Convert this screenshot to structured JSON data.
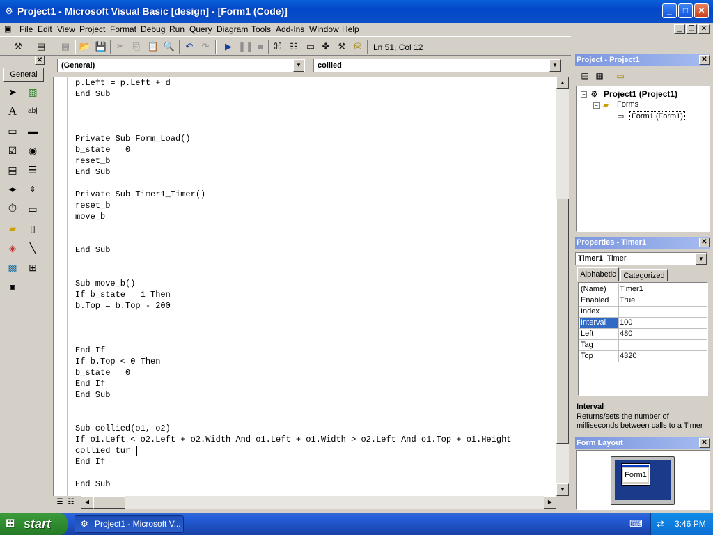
{
  "window": {
    "title": "Project1 - Microsoft Visual Basic [design] - [Form1 (Code)]",
    "minimize_glyph": "_",
    "maximize_glyph": "□",
    "close_glyph": "✕"
  },
  "menu": {
    "items": [
      "File",
      "Edit",
      "View",
      "Project",
      "Format",
      "Debug",
      "Run",
      "Query",
      "Diagram",
      "Tools",
      "Add-Ins",
      "Window",
      "Help"
    ]
  },
  "toolbar": {
    "status": "Ln 51, Col 12",
    "icons": [
      "add-project-icon",
      "add-form-icon",
      "menu-editor-icon",
      "open-icon",
      "save-icon",
      "cut-icon",
      "copy-icon",
      "paste-icon",
      "find-icon",
      "undo-icon",
      "redo-icon",
      "start-icon",
      "break-icon",
      "end-icon",
      "project-explorer-icon",
      "properties-icon",
      "form-layout-icon",
      "object-browser-icon",
      "toolbox-icon",
      "data-view-icon"
    ]
  },
  "toolbox": {
    "tab_label": "General",
    "tools": [
      "pointer",
      "picture-box",
      "label",
      "text-box",
      "frame",
      "command-button",
      "check-box",
      "option-button",
      "combo-box",
      "list-box",
      "hscroll-bar",
      "vscroll-bar",
      "timer",
      "drive-list-box",
      "dir-list-box",
      "file-list-box",
      "shape",
      "line",
      "image",
      "data",
      "ole"
    ]
  },
  "code_window": {
    "object_combo": "(General)",
    "procedure_combo": "collied",
    "lines": [
      "p.Left = p.Left + d",
      "End Sub",
      "Private Sub Form_Load()",
      "b_state = 0",
      "reset_b",
      "End Sub",
      "Private Sub Timer1_Timer()",
      "reset_b",
      "move_b",
      "End Sub",
      "Sub move_b()",
      "If b_state = 1 Then",
      "b.Top = b.Top - 200",
      "End If",
      "If b.Top < 0 Then",
      "b_state = 0",
      "End If",
      "End Sub",
      "Sub collied(o1, o2)",
      "If o1.Left < o2.Left + o2.Width And o1.Left + o1.Width > o2.Left And o1.Top + o1.Height",
      "collied=tur",
      "End If",
      "End Sub"
    ]
  },
  "project_panel": {
    "title": "Project - Project1",
    "tree": {
      "project": "Project1 (Project1)",
      "folder": "Forms",
      "form": "Form1 (Form1)"
    }
  },
  "properties_panel": {
    "title": "Properties - Timer1",
    "object_name": "Timer1",
    "object_type": "Timer",
    "tabs": [
      "Alphabetic",
      "Categorized"
    ],
    "active_tab": "Alphabetic",
    "rows": [
      {
        "name": "(Name)",
        "value": "Timer1"
      },
      {
        "name": "Enabled",
        "value": "True"
      },
      {
        "name": "Index",
        "value": ""
      },
      {
        "name": "Interval",
        "value": "100"
      },
      {
        "name": "Left",
        "value": "480"
      },
      {
        "name": "Tag",
        "value": ""
      },
      {
        "name": "Top",
        "value": "4320"
      }
    ],
    "selected_row": "Interval",
    "description_title": "Interval",
    "description_text": "Returns/sets the number of milliseconds between calls to a Timer"
  },
  "form_layout_panel": {
    "title": "Form Layout",
    "form_label": "Form1"
  },
  "taskbar": {
    "start_label": "start",
    "task_item": "Project1 - Microsoft V...",
    "clock": "3:46 PM"
  },
  "colors": {
    "titlebar": "#0348c8",
    "selection": "#316ac5",
    "start_button": "#2e8b2e",
    "taskbar": "#245edb"
  }
}
